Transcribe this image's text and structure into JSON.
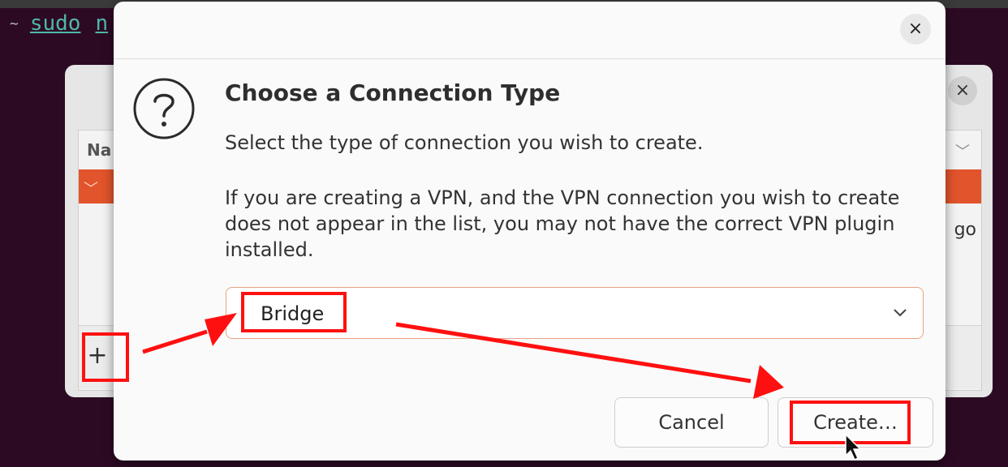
{
  "terminal": {
    "cmd": "sudo",
    "cmd_partial": "n"
  },
  "background_window": {
    "close_glyph": "×",
    "list_header": "Na",
    "tail_text": "go",
    "add_button": "+"
  },
  "dialog": {
    "close_glyph": "×",
    "heading": "Choose a Connection Type",
    "subtext": "Select the type of connection you wish to create.",
    "vpn_note": "If you are creating a VPN, and the VPN connection you wish to create does not appear in the list, you may not have the correct VPN plugin installed.",
    "connection_type": {
      "selected": "Bridge"
    },
    "buttons": {
      "cancel": "Cancel",
      "create": "Create…"
    }
  },
  "colors": {
    "annotation_red": "#ff1010",
    "accent_orange": "#e2542b",
    "terminal_bg": "#2d0a24"
  }
}
